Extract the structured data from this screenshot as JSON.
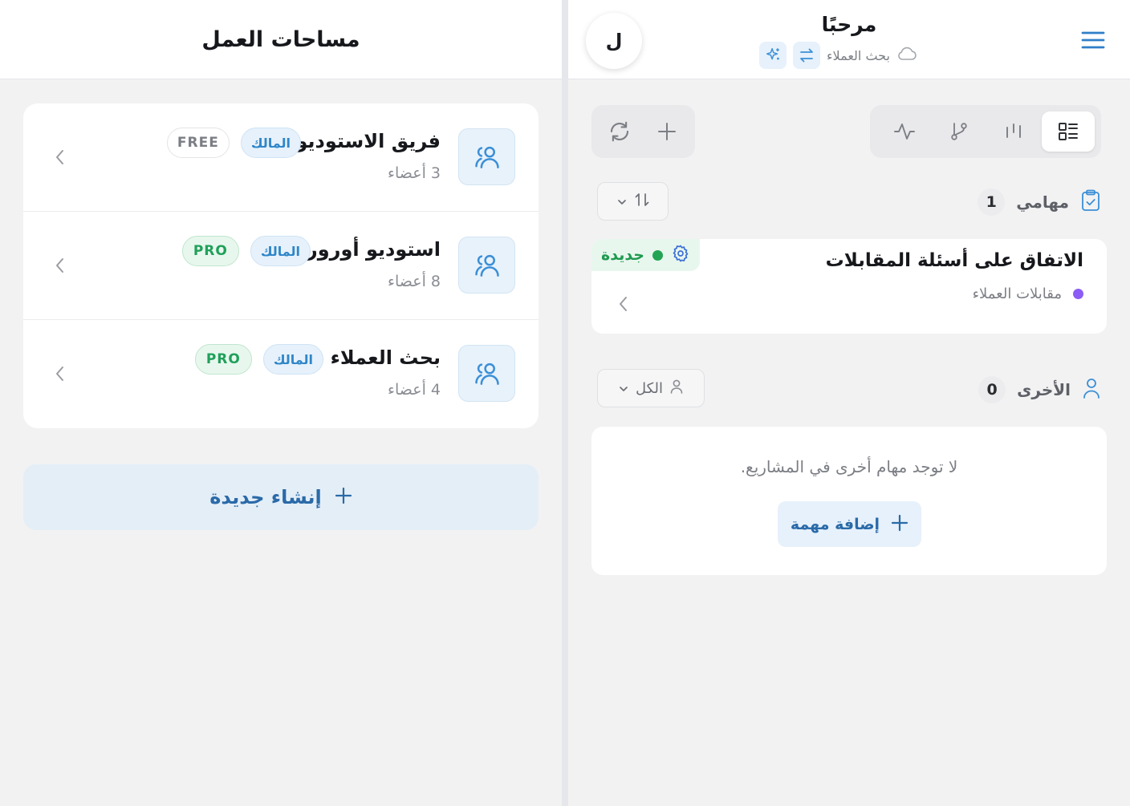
{
  "colors": {
    "accent": "#3b8fd6",
    "pro_green": "#21a05a",
    "status_green": "#22a454",
    "project_purple": "#8b5cf6"
  },
  "workspaces_panel": {
    "title": "مساحات العمل",
    "items": [
      {
        "name": "فريق الاستوديو",
        "members": "3 أعضاء",
        "role": "المالك",
        "plan": "FREE"
      },
      {
        "name": "استوديو أورورا",
        "members": "8 أعضاء",
        "role": "المالك",
        "plan": "PRO"
      },
      {
        "name": "بحث العملاء",
        "members": "4 أعضاء",
        "role": "المالك",
        "plan": "PRO"
      }
    ],
    "create_label": "إنشاء جديدة"
  },
  "header": {
    "greeting": "مرحبًا",
    "current_workspace": "بحث العملاء",
    "avatar_initial": "ل",
    "icons": {
      "menu": "hamburger-icon",
      "cloud": "cloud-icon",
      "swap": "swap-icon",
      "sparkle": "sparkle-icon"
    }
  },
  "toolbar": {
    "view_tabs": [
      "list-view-icon",
      "columns-view-icon",
      "branch-view-icon",
      "activity-view-icon"
    ],
    "active_view": "list-view-icon",
    "actions": [
      "add-icon",
      "refresh-icon"
    ]
  },
  "my_tasks": {
    "title": "مهامي",
    "count": "1",
    "tasks": [
      {
        "title": "الاتفاق على أسئلة المقابلات",
        "project": "مقابلات العملاء",
        "status": "جديدة"
      }
    ]
  },
  "others": {
    "title": "الأخرى",
    "count": "0",
    "filter_label": "الكل",
    "empty_text": "لا توجد مهام أخرى في المشاريع.",
    "add_label": "إضافة مهمة"
  }
}
